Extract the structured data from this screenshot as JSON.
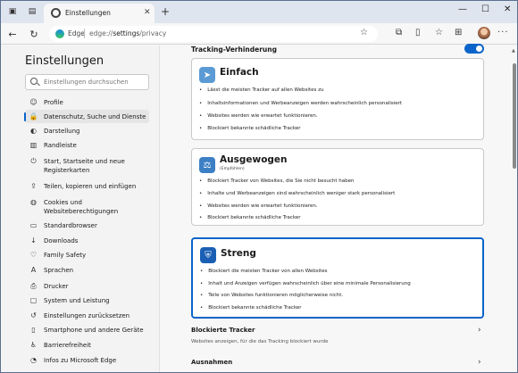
{
  "tab": {
    "title": "Einstellungen"
  },
  "address": {
    "site": "Edge",
    "url_prefix": "edge://",
    "url_path": "settings",
    "url_suffix": "/privacy"
  },
  "sidebar": {
    "title": "Einstellungen",
    "search_placeholder": "Einstellungen durchsuchen",
    "items": [
      {
        "label": "Profile",
        "icon": "person-icon"
      },
      {
        "label": "Datenschutz, Suche und Dienste",
        "icon": "lock-icon",
        "active": true
      },
      {
        "label": "Darstellung",
        "icon": "paint-icon"
      },
      {
        "label": "Randleiste",
        "icon": "sidebar-icon"
      },
      {
        "label": "Start, Startseite und neue Registerkarten",
        "icon": "power-icon"
      },
      {
        "label": "Teilen, kopieren und einfügen",
        "icon": "share-icon"
      },
      {
        "label": "Cookies und Websiteberechtigungen",
        "icon": "cookie-icon"
      },
      {
        "label": "Standardbrowser",
        "icon": "browser-icon"
      },
      {
        "label": "Downloads",
        "icon": "download-icon"
      },
      {
        "label": "Family Safety",
        "icon": "family-icon"
      },
      {
        "label": "Sprachen",
        "icon": "language-icon"
      },
      {
        "label": "Drucker",
        "icon": "printer-icon"
      },
      {
        "label": "System und Leistung",
        "icon": "system-icon"
      },
      {
        "label": "Einstellungen zurücksetzen",
        "icon": "reset-icon"
      },
      {
        "label": "Smartphone und andere Geräte",
        "icon": "phone-icon"
      },
      {
        "label": "Barrierefreiheit",
        "icon": "accessibility-icon"
      },
      {
        "label": "Infos zu Microsoft Edge",
        "icon": "edge-icon"
      }
    ]
  },
  "tracking": {
    "title": "Tracking-Verhinderung",
    "enabled": true,
    "cards": [
      {
        "title": "Einfach",
        "subtitle": "",
        "selected": false,
        "icon_color": "#5b9bd5",
        "bullets": [
          "Lässt die meisten Tracker auf allen Websites zu",
          "Inhaltsinformationen und Werbeanzeigen werden wahrscheinlich personalisiert",
          "Websites werden wie erwartet funktionieren.",
          "Blockiert bekannte schädliche Tracker"
        ]
      },
      {
        "title": "Ausgewogen",
        "subtitle": "(Empfohlen)",
        "selected": false,
        "icon_color": "#3c7fc4",
        "bullets": [
          "Blockiert Tracker von Websites, die Sie nicht besucht haben",
          "Inhalte und Werbeanzeigen sind wahrscheinlich weniger stark personalisiert",
          "Websites werden wie erwartet funktionieren.",
          "Blockiert bekannte schädliche Tracker"
        ]
      },
      {
        "title": "Streng",
        "subtitle": "",
        "selected": true,
        "icon_color": "#1a5fb4",
        "bullets": [
          "Blockiert die meisten Tracker von allen Websites",
          "Inhalt und Anzeigen verfügen wahrscheinlich über eine minimale Personalisierung",
          "Teile von Websites funktionieren möglicherweise nicht.",
          "Blockiert bekannte schädliche Tracker"
        ]
      }
    ]
  },
  "blocked": {
    "title": "Blockierte Tracker",
    "subtitle": "Websites anzeigen, für die das Tracking blockiert wurde"
  },
  "exceptions": {
    "title": "Ausnahmen"
  },
  "colors": {
    "accent": "#0a64c9"
  }
}
